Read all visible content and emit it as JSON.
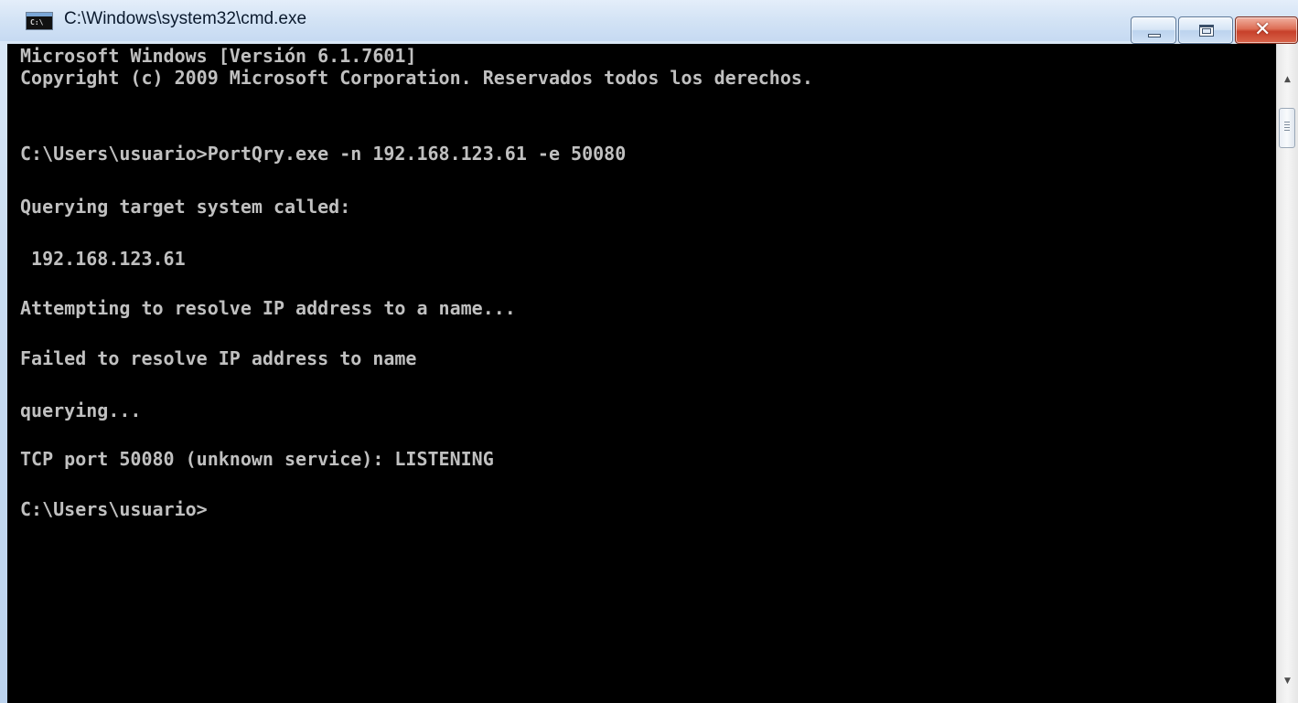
{
  "window": {
    "title": "C:\\Windows\\system32\\cmd.exe",
    "icon": "cmd-prompt-icon",
    "icon_glyph": "C:\\",
    "controls": {
      "minimize": "minimize-icon",
      "maximize": "maximize-icon",
      "close_glyph": "✕"
    }
  },
  "console": {
    "lines": [
      "Microsoft Windows [Versión 6.1.7601]",
      "Copyright (c) 2009 Microsoft Corporation. Reservados todos los derechos.",
      "C:\\Users\\usuario>PortQry.exe -n 192.168.123.61 -e 50080",
      "Querying target system called:",
      " 192.168.123.61",
      "Attempting to resolve IP address to a name...",
      "Failed to resolve IP address to name",
      "querying...",
      "TCP port 50080 (unknown service): LISTENING",
      "C:\\Users\\usuario>"
    ],
    "colors": {
      "background": "#000000",
      "text": "#c0c0c0"
    }
  },
  "scrollbar": {
    "up_arrow": "▲",
    "down_arrow": "▼"
  }
}
